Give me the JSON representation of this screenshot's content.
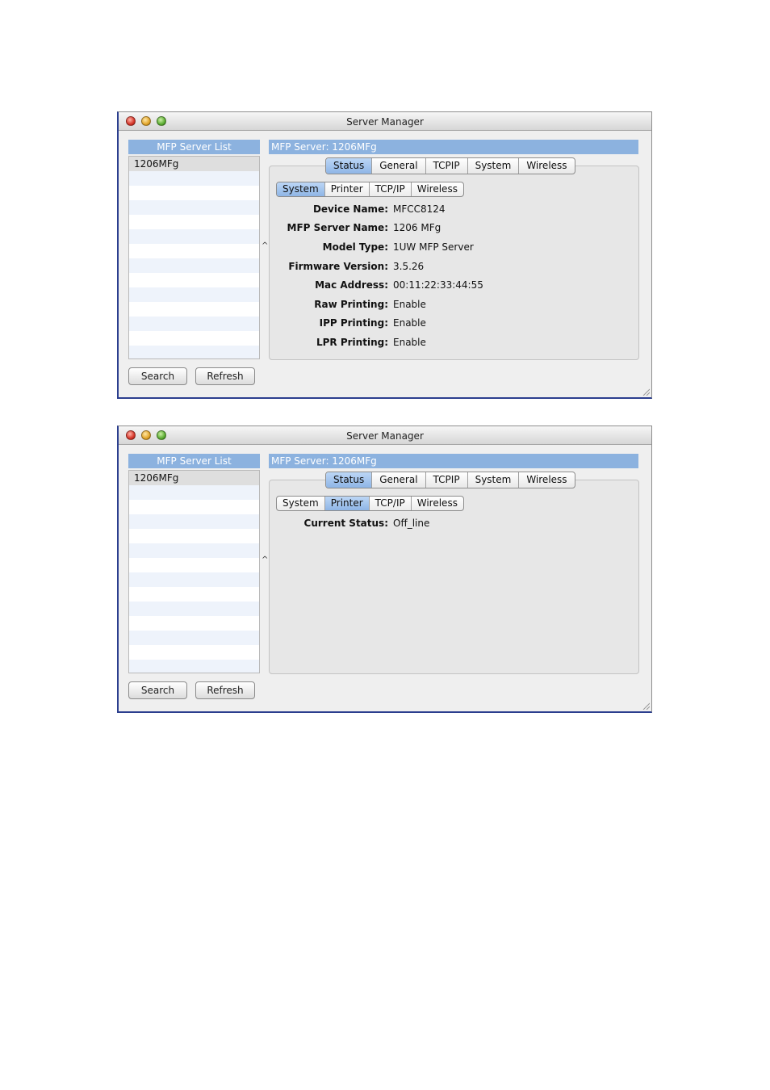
{
  "windows": [
    {
      "title": "Server Manager",
      "list_header": "MFP Server List",
      "list_items": [
        "1206MFg"
      ],
      "buttons": {
        "search": "Search",
        "refresh": "Refresh"
      },
      "server_header": "MFP Server: 1206MFg",
      "tabs": [
        {
          "label": "Status",
          "active": true
        },
        {
          "label": "General",
          "active": false
        },
        {
          "label": "TCPIP",
          "active": false
        },
        {
          "label": "System",
          "active": false
        },
        {
          "label": "Wireless",
          "active": false
        }
      ],
      "subtabs": [
        {
          "label": "System",
          "active": true
        },
        {
          "label": "Printer",
          "active": false
        },
        {
          "label": "TCP/IP",
          "active": false
        },
        {
          "label": "Wireless",
          "active": false
        }
      ],
      "fields": [
        {
          "label": "Device Name:",
          "value": "MFCC8124"
        },
        {
          "label": "MFP Server Name:",
          "value": "1206 MFg"
        },
        {
          "label": "Model Type:",
          "value": "1UW MFP Server"
        },
        {
          "label": "Firmware Version:",
          "value": "3.5.26"
        },
        {
          "label": "Mac Address:",
          "value": "00:11:22:33:44:55"
        },
        {
          "label": "Raw Printing:",
          "value": "Enable"
        },
        {
          "label": "IPP Printing:",
          "value": "Enable"
        },
        {
          "label": "LPR Printing:",
          "value": "Enable"
        }
      ]
    },
    {
      "title": "Server Manager",
      "list_header": "MFP Server List",
      "list_items": [
        "1206MFg"
      ],
      "buttons": {
        "search": "Search",
        "refresh": "Refresh"
      },
      "server_header": "MFP Server: 1206MFg",
      "tabs": [
        {
          "label": "Status",
          "active": true
        },
        {
          "label": "General",
          "active": false
        },
        {
          "label": "TCPIP",
          "active": false
        },
        {
          "label": "System",
          "active": false
        },
        {
          "label": "Wireless",
          "active": false
        }
      ],
      "subtabs": [
        {
          "label": "System",
          "active": false
        },
        {
          "label": "Printer",
          "active": true
        },
        {
          "label": "TCP/IP",
          "active": false
        },
        {
          "label": "Wireless",
          "active": false
        }
      ],
      "fields": [
        {
          "label": "Current Status:",
          "value": "Off_line"
        }
      ]
    }
  ]
}
